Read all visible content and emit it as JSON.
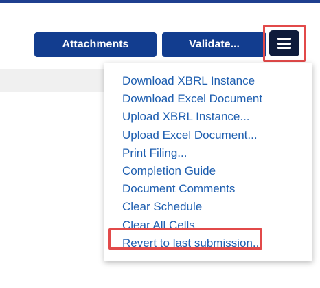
{
  "toolbar": {
    "attachments_label": "Attachments",
    "validate_label": "Validate...",
    "menu_icon": "hamburger-icon"
  },
  "menu": {
    "items": [
      {
        "label": "Download XBRL Instance"
      },
      {
        "label": "Download Excel Document"
      },
      {
        "label": "Upload XBRL Instance..."
      },
      {
        "label": "Upload Excel Document..."
      },
      {
        "label": "Print Filing..."
      },
      {
        "label": "Completion Guide"
      },
      {
        "label": "Document Comments"
      },
      {
        "label": "Clear Schedule"
      },
      {
        "label": "Clear All Cells..."
      },
      {
        "label": "Revert to last submission..."
      }
    ]
  },
  "colors": {
    "button_bg": "#123d8f",
    "menu_button_bg": "#0e1b3b",
    "link_text": "#1f5fb0",
    "highlight_border": "#e24a4a",
    "top_rule": "#1f3f8f"
  }
}
